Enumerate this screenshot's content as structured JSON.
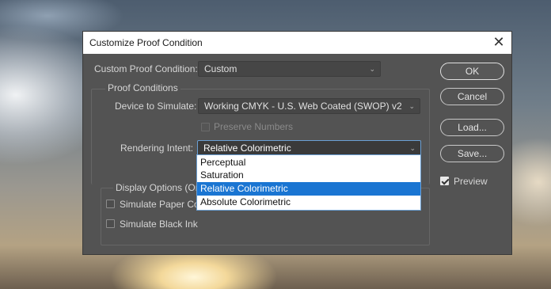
{
  "dialog": {
    "title": "Customize Proof Condition",
    "custom_condition_label": "Custom Proof Condition:",
    "custom_condition_value": "Custom",
    "proof_conditions_label": "Proof Conditions",
    "device_label": "Device to Simulate:",
    "device_value": "Working CMYK - U.S. Web Coated (SWOP) v2",
    "preserve_numbers_label": "Preserve Numbers",
    "rendering_intent_label": "Rendering Intent:",
    "rendering_intent_value": "Relative Colorimetric",
    "rendering_intent_options": [
      "Perceptual",
      "Saturation",
      "Relative Colorimetric",
      "Absolute Colorimetric"
    ],
    "display_options_label": "Display Options (On-",
    "simulate_paper_label": "Simulate Paper Col",
    "simulate_ink_label": "Simulate Black Ink",
    "buttons": {
      "ok": "OK",
      "cancel": "Cancel",
      "load": "Load...",
      "save": "Save..."
    },
    "preview_label": "Preview"
  },
  "icons": {
    "close": "close-icon",
    "dropdown": "chevron-down-icon"
  }
}
